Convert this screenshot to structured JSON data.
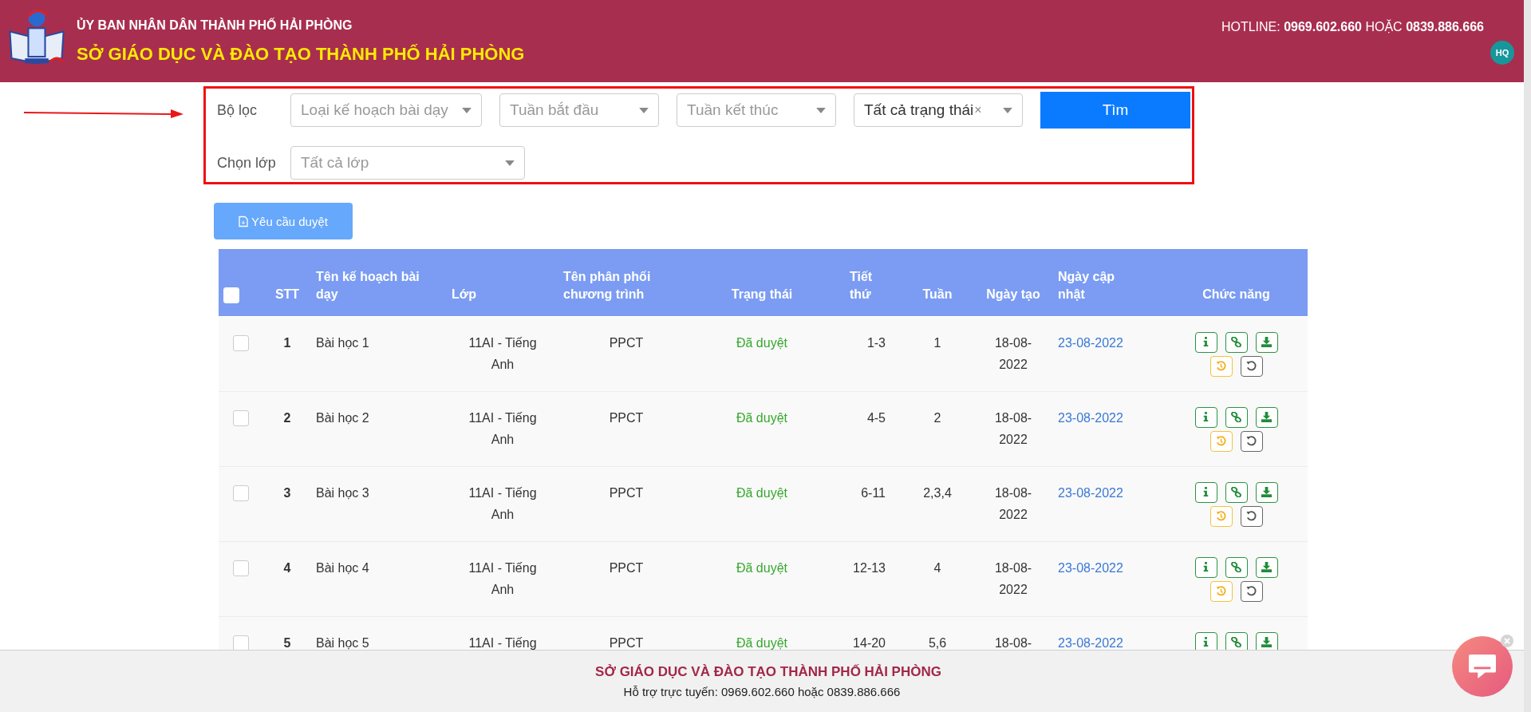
{
  "header": {
    "authority": "ỦY BAN NHÂN DÂN THÀNH PHỐ HẢI PHÒNG",
    "title": "SỞ GIÁO DỤC VÀ ĐÀO TẠO THÀNH PHỐ HẢI PHÒNG",
    "hotline": "HOTLINE: **0969.602.660** HOẶC **0839.886.666**",
    "avatar": "HQ"
  },
  "filters": {
    "label": "Bộ lọc",
    "selects": [
      {
        "placeholder": "Loại kế hoạch bài dạy"
      },
      {
        "placeholder": "Tuần bắt đầu"
      },
      {
        "placeholder": "Tuần kết thúc"
      },
      {
        "value": "Tất cả trạng thái",
        "clear": "×"
      }
    ],
    "search_button": "Tìm",
    "class_label": "Chọn lớp",
    "class_select": {
      "placeholder": "Tất cả lớp"
    }
  },
  "request_button": "Yêu cầu duyệt",
  "table": {
    "select_all": {
      "checked": false
    },
    "columns": [
      "STT",
      "Tên kế hoạch bài dạy",
      "Lớp",
      "Tên phân phối chương trình",
      "Trạng thái",
      "Tiết thứ",
      "Tuần",
      "Ngày tạo",
      "Ngày cập nhật",
      "Chức năng"
    ],
    "rows": [
      {
        "checked": false,
        "stt": "1",
        "name": "Bài học 1",
        "class": "11AI - Tiếng Anh",
        "program": "PPCT",
        "status": "Đã duyệt",
        "periods": "1-3",
        "weeks": "1",
        "created": "18-08-2022",
        "updated": "23-08-2022",
        "actions": [
          {
            "kind": "info"
          },
          {
            "kind": "link"
          },
          {
            "kind": "download"
          },
          {
            "kind": "restore"
          },
          {
            "kind": "reset"
          }
        ]
      },
      {
        "checked": false,
        "stt": "2",
        "name": "Bài học 2",
        "class": "11AI - Tiếng Anh",
        "program": "PPCT",
        "status": "Đã duyệt",
        "periods": "4-5",
        "weeks": "2",
        "created": "18-08-2022",
        "updated": "23-08-2022",
        "actions": [
          {
            "kind": "info"
          },
          {
            "kind": "link"
          },
          {
            "kind": "download"
          },
          {
            "kind": "restore"
          },
          {
            "kind": "reset"
          }
        ]
      },
      {
        "checked": false,
        "stt": "3",
        "name": "Bài học 3",
        "class": "11AI - Tiếng Anh",
        "program": "PPCT",
        "status": "Đã duyệt",
        "periods": "6-11",
        "weeks": "2,3,4",
        "created": "18-08-2022",
        "updated": "23-08-2022",
        "actions": [
          {
            "kind": "info"
          },
          {
            "kind": "link"
          },
          {
            "kind": "download"
          },
          {
            "kind": "restore"
          },
          {
            "kind": "reset"
          }
        ]
      },
      {
        "checked": false,
        "stt": "4",
        "name": "Bài học 4",
        "class": "11AI - Tiếng Anh",
        "program": "PPCT",
        "status": "Đã duyệt",
        "periods": "12-13",
        "weeks": "4",
        "created": "18-08-2022",
        "updated": "23-08-2022",
        "actions": [
          {
            "kind": "info"
          },
          {
            "kind": "link"
          },
          {
            "kind": "download"
          },
          {
            "kind": "restore"
          },
          {
            "kind": "reset"
          }
        ]
      },
      {
        "checked": false,
        "stt": "5",
        "name": "Bài học 5",
        "class": "11AI - Tiếng",
        "program": "PPCT",
        "status": "Đã duyệt",
        "periods": "14-20",
        "weeks": "5,6",
        "created": "18-08-",
        "updated": "23-08-2022",
        "actions": [
          {
            "kind": "info"
          },
          {
            "kind": "link"
          },
          {
            "kind": "download"
          }
        ]
      }
    ]
  },
  "footer": {
    "title": "SỞ GIÁO DỤC VÀ ĐÀO TẠO THÀNH PHỐ HẢI PHÒNG",
    "support": "Hỗ trợ trực tuyến: 0969.602.660 hoặc 0839.886.666"
  }
}
